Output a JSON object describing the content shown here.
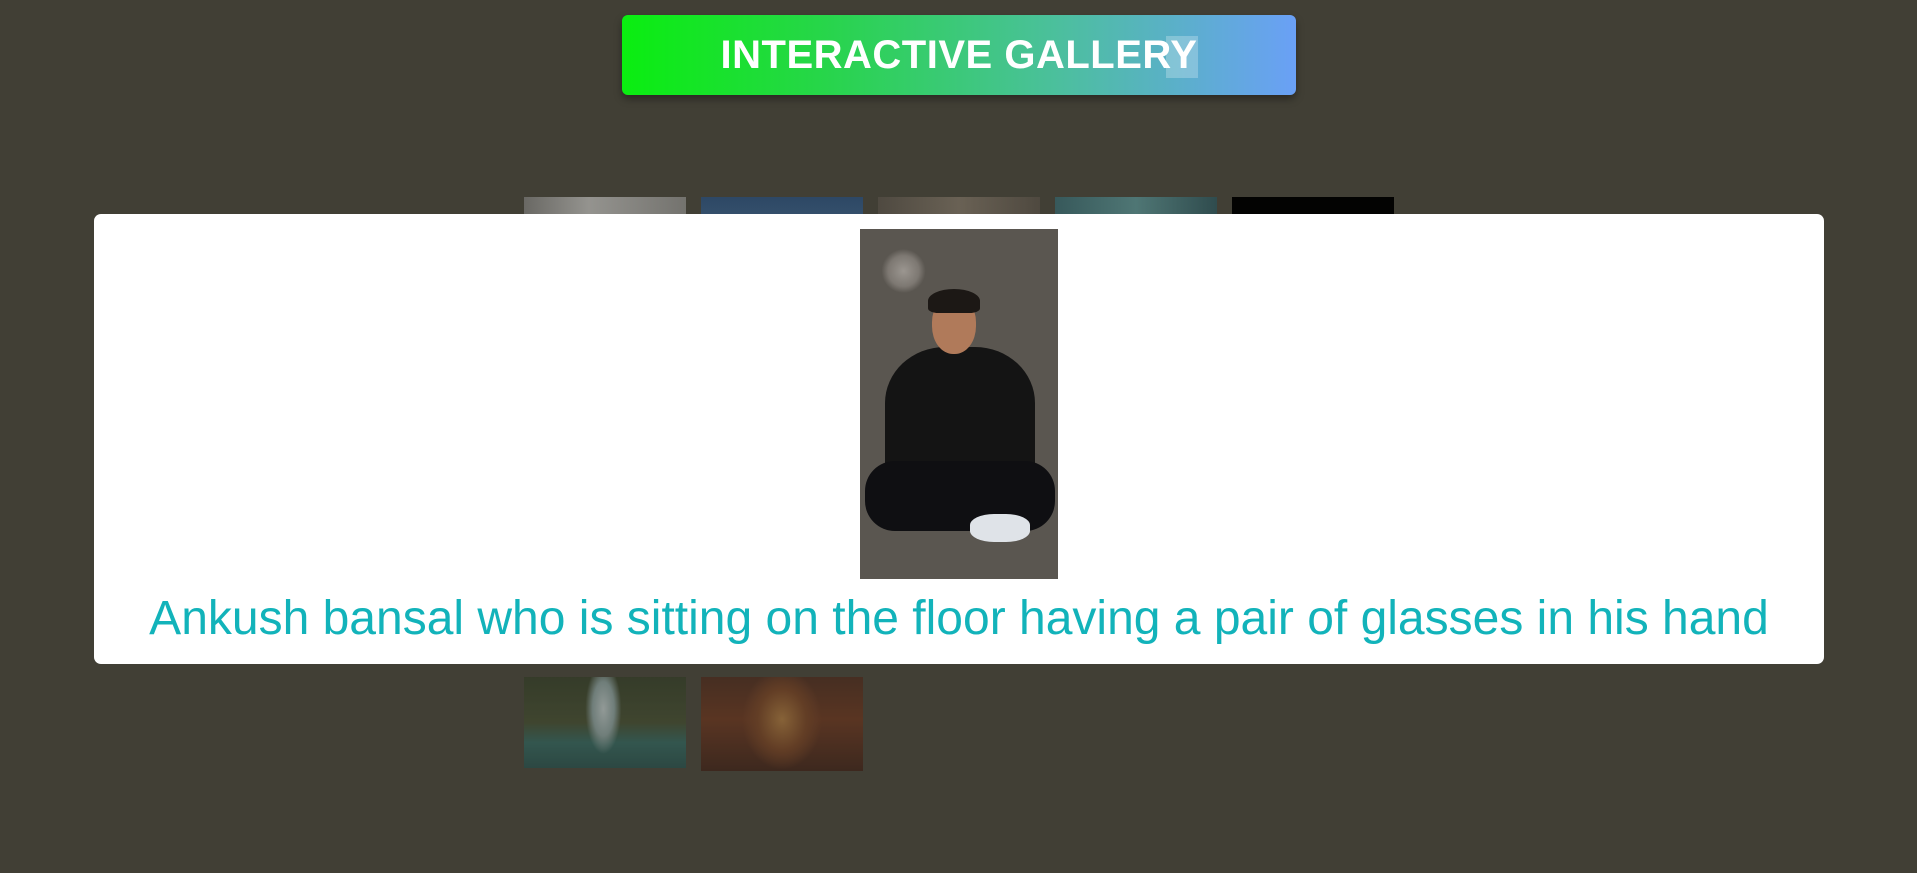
{
  "header": {
    "title": "INTERACTIVE GALLERY"
  },
  "gallery": {
    "thumbnails": [
      {
        "subject": "grey-photo"
      },
      {
        "subject": "blue-photo"
      },
      {
        "subject": "stone-photo"
      },
      {
        "subject": "teal-photo"
      },
      {
        "subject": "dark-photo"
      },
      {
        "subject": "waterfall-photo"
      },
      {
        "subject": "autumn-forest-photo"
      }
    ]
  },
  "modal": {
    "image_subject": "man-sitting-on-floor-photo",
    "caption": "Ankush bansal who is sitting on the floor having a pair of glasses in his hand"
  },
  "colors": {
    "background": "#413f35",
    "caption": "#12b3ba",
    "title_gradient_start": "#0aee10",
    "title_gradient_end": "#6aa0f6"
  }
}
